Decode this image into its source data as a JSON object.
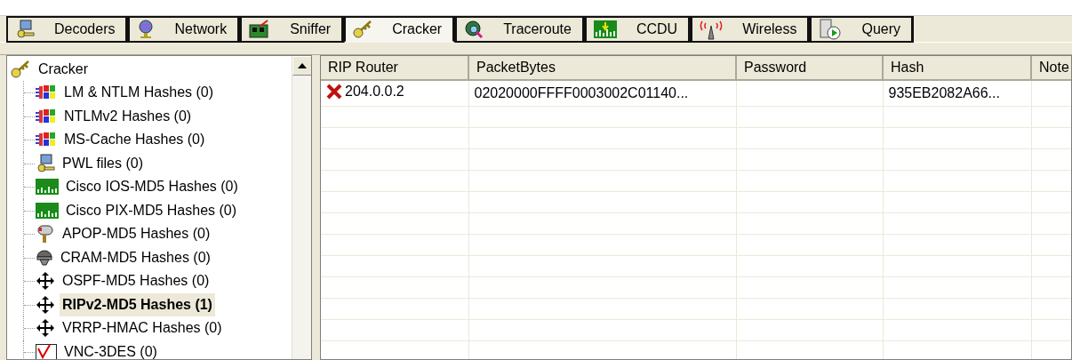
{
  "tabs": [
    {
      "label": "Decoders",
      "kind": "decoders",
      "selected": false
    },
    {
      "label": "Network",
      "kind": "network",
      "selected": false
    },
    {
      "label": "Sniffer",
      "kind": "sniffer",
      "selected": false
    },
    {
      "label": "Cracker",
      "kind": "cracker",
      "selected": true
    },
    {
      "label": "Traceroute",
      "kind": "traceroute",
      "selected": false
    },
    {
      "label": "CCDU",
      "kind": "ccdu",
      "selected": false
    },
    {
      "label": "Wireless",
      "kind": "wireless",
      "selected": false
    },
    {
      "label": "Query",
      "kind": "query",
      "selected": false
    }
  ],
  "tree": {
    "label": "Cracker",
    "kind": "cracker",
    "children": [
      {
        "label": "LM & NTLM Hashes (0)",
        "kind": "windows",
        "selected": false
      },
      {
        "label": "NTLMv2 Hashes (0)",
        "kind": "windows",
        "selected": false
      },
      {
        "label": "MS-Cache Hashes (0)",
        "kind": "windows",
        "selected": false
      },
      {
        "label": "PWL files (0)",
        "kind": "pwl",
        "selected": false
      },
      {
        "label": "Cisco IOS-MD5 Hashes (0)",
        "kind": "cisco",
        "selected": false
      },
      {
        "label": "Cisco PIX-MD5 Hashes (0)",
        "kind": "cisco",
        "selected": false
      },
      {
        "label": "APOP-MD5 Hashes (0)",
        "kind": "apop",
        "selected": false
      },
      {
        "label": "CRAM-MD5 Hashes (0)",
        "kind": "cram",
        "selected": false
      },
      {
        "label": "OSPF-MD5 Hashes (0)",
        "kind": "router",
        "selected": false
      },
      {
        "label": "RIPv2-MD5 Hashes (1)",
        "kind": "router",
        "selected": true
      },
      {
        "label": "VRRP-HMAC Hashes (0)",
        "kind": "router",
        "selected": false
      },
      {
        "label": "VNC-3DES (0)",
        "kind": "vnc",
        "selected": false
      }
    ]
  },
  "table": {
    "columns": [
      "RIP Router",
      "PacketBytes",
      "Password",
      "Hash",
      "Note"
    ],
    "rows": [
      {
        "cells": [
          "204.0.0.2",
          "02020000FFFF0003002C01140...",
          "",
          "935EB2082A66...",
          ""
        ],
        "cracked": false
      }
    ]
  }
}
